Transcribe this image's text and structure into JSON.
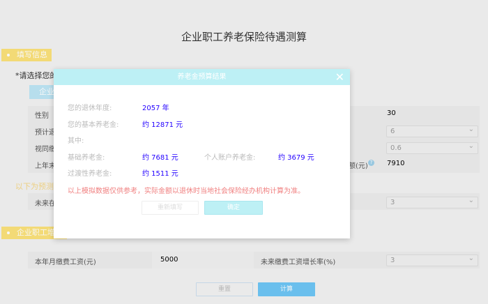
{
  "page": {
    "title": "企业职工养老保险待遇测算"
  },
  "section1": {
    "ribbon": "填写信息",
    "prompt": "*请选择您的",
    "tab": "企业"
  },
  "form": {
    "rows": [
      {
        "label": "性别",
        "value": "30"
      },
      {
        "label": "预计退",
        "value": "6"
      },
      {
        "label": "视同缴",
        "value": "0.6"
      },
      {
        "label": "上年末",
        "label_right": "额(元)",
        "value": "7910"
      }
    ],
    "forecast_note": "以下为预测",
    "future_row": {
      "label": "未来在",
      "value": "3"
    }
  },
  "section2": {
    "ribbon": "企业职工增",
    "wage_label": "本年月缴费工资(元)",
    "wage_value": "5000",
    "growth_label": "未来缴费工资增长率(%)",
    "growth_value": "3"
  },
  "buttons": {
    "reset": "重置",
    "calc": "计算"
  },
  "modal": {
    "title": "养老金预算结果",
    "retire_year_label": "您的退休年度:",
    "retire_year": "2057 年",
    "basic_label": "您的基本养老金:",
    "basic": "约 12871 元",
    "of_which": "其中:",
    "base_label": "基础养老金:",
    "base": "约 7681 元",
    "personal_label": "个人账户养老金:",
    "personal": "约 3679 元",
    "transition_label": "过渡性养老金:",
    "transition": "约 1511 元",
    "disclaimer": "以上模拟数据仅供参考，实际金额以退休时当地社会保险经办机构计算为准。",
    "refill": "重新填写",
    "ok": "确定"
  }
}
